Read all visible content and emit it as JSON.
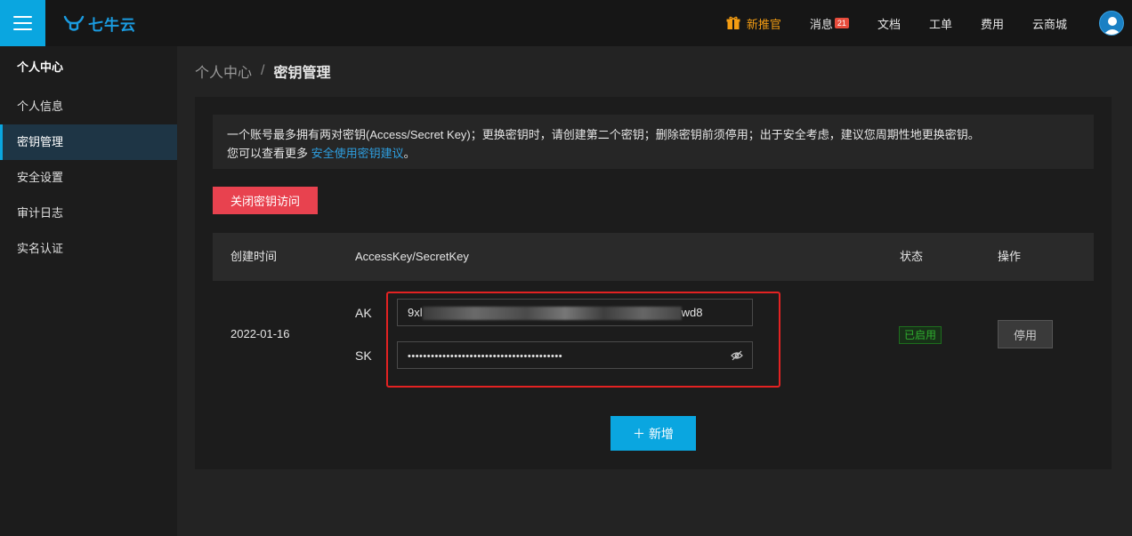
{
  "brand": {
    "name": "七牛云",
    "accent": "#0aa6e0"
  },
  "topnav": {
    "promo": "新推官",
    "messages": "消息",
    "message_count": "21",
    "docs": "文档",
    "tickets": "工单",
    "billing": "费用",
    "market": "云商城"
  },
  "sidebar": {
    "title": "个人中心",
    "items": [
      {
        "label": "个人信息"
      },
      {
        "label": "密钥管理"
      },
      {
        "label": "安全设置"
      },
      {
        "label": "审计日志"
      },
      {
        "label": "实名认证"
      }
    ]
  },
  "breadcrumb": {
    "parent": "个人中心",
    "separator": "/",
    "current": "密钥管理"
  },
  "notice": {
    "line1": "一个账号最多拥有两对密钥(Access/Secret Key)；更换密钥时，请创建第二个密钥；删除密钥前须停用；出于安全考虑，建议您周期性地更换密钥。",
    "line2_prefix": "您可以查看更多",
    "line2_link": "安全使用密钥建议",
    "line2_suffix": "。"
  },
  "buttons": {
    "close_access": "关闭密钥访问",
    "disable": "停用",
    "add": "新增",
    "add_icon": "＋"
  },
  "table": {
    "columns": [
      "创建时间",
      "AccessKey/SecretKey",
      "状态",
      "操作"
    ],
    "rows": [
      {
        "created": "2022-01-16",
        "ak_label": "AK",
        "ak_prefix": "9xl",
        "ak_suffix": "wd8",
        "sk_label": "SK",
        "sk_masked": "••••••••••••••••••••••••••••••••••••••••",
        "status": "已启用"
      }
    ]
  },
  "icons": {
    "menu": "hamburger-icon",
    "gift": "gift-icon",
    "avatar": "user-avatar-icon",
    "eye": "eye-hidden-icon"
  }
}
